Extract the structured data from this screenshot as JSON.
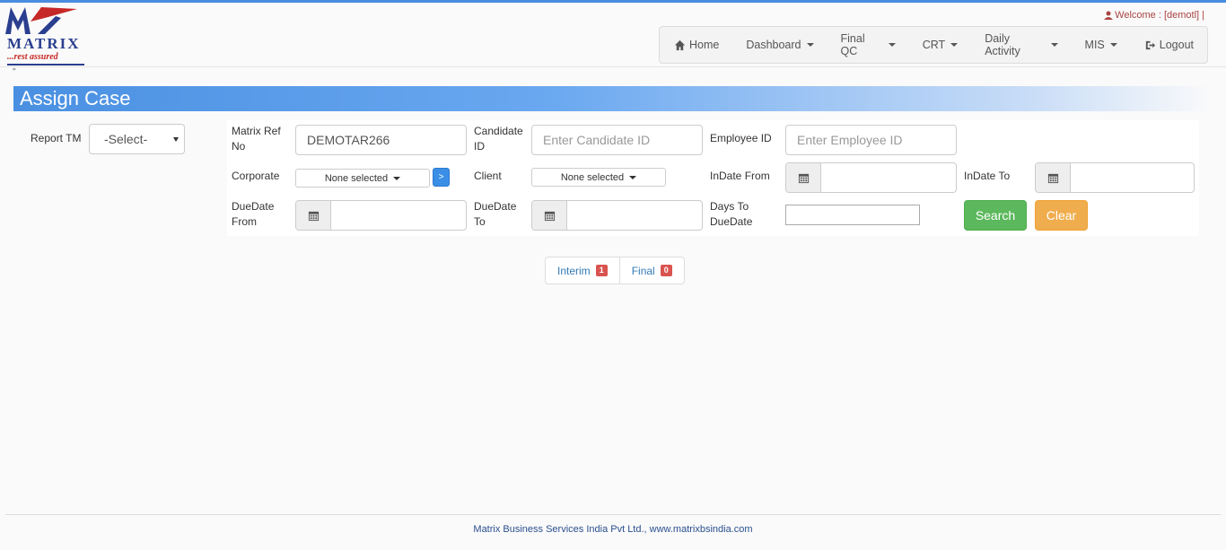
{
  "header": {
    "logo_text": "MATRIX",
    "logo_tagline": "...rest assured",
    "quote_mark": "\"",
    "welcome": "Welcome : [demotl] |"
  },
  "nav": {
    "items": [
      {
        "label": "Home",
        "icon": "home-icon"
      },
      {
        "label": "Dashboard",
        "dropdown": true
      },
      {
        "label": "Final QC",
        "dropdown": true
      },
      {
        "label": "CRT",
        "dropdown": true
      },
      {
        "label": "Daily Activity",
        "dropdown": true
      },
      {
        "label": "MIS",
        "dropdown": true
      }
    ],
    "logout": "Logout"
  },
  "page": {
    "title": "Assign Case"
  },
  "filters": {
    "report_tm": {
      "label": "Report TM",
      "value": "-Select-"
    },
    "matrix_ref": {
      "label": "Matrix Ref No",
      "value": "DEMOTAR266"
    },
    "candidate_id": {
      "label": "Candidate ID",
      "placeholder": "Enter Candidate ID"
    },
    "employee_id": {
      "label": "Employee ID",
      "placeholder": "Enter Employee ID"
    },
    "corporate": {
      "label": "Corporate",
      "value": "None selected",
      "go": ">"
    },
    "client": {
      "label": "Client",
      "value": "None selected"
    },
    "indate_from": {
      "label": "InDate From"
    },
    "indate_to": {
      "label": "InDate To"
    },
    "duedate_from": {
      "label": "DueDate From"
    },
    "duedate_to": {
      "label": "DueDate To"
    },
    "days_to_duedate": {
      "label": "Days To DueDate"
    },
    "search_button": "Search",
    "clear_button": "Clear"
  },
  "tabs": [
    {
      "label": "Interim",
      "count": "1"
    },
    {
      "label": "Final",
      "count": "0"
    }
  ],
  "footer": {
    "text": "Matrix Business Services India Pvt Ltd., www.matrixbsindia.com"
  },
  "colors": {
    "brand_blue": "#4a90e2",
    "search": "#5cb85c",
    "clear": "#f0ad4e",
    "badge": "#d9534f"
  }
}
